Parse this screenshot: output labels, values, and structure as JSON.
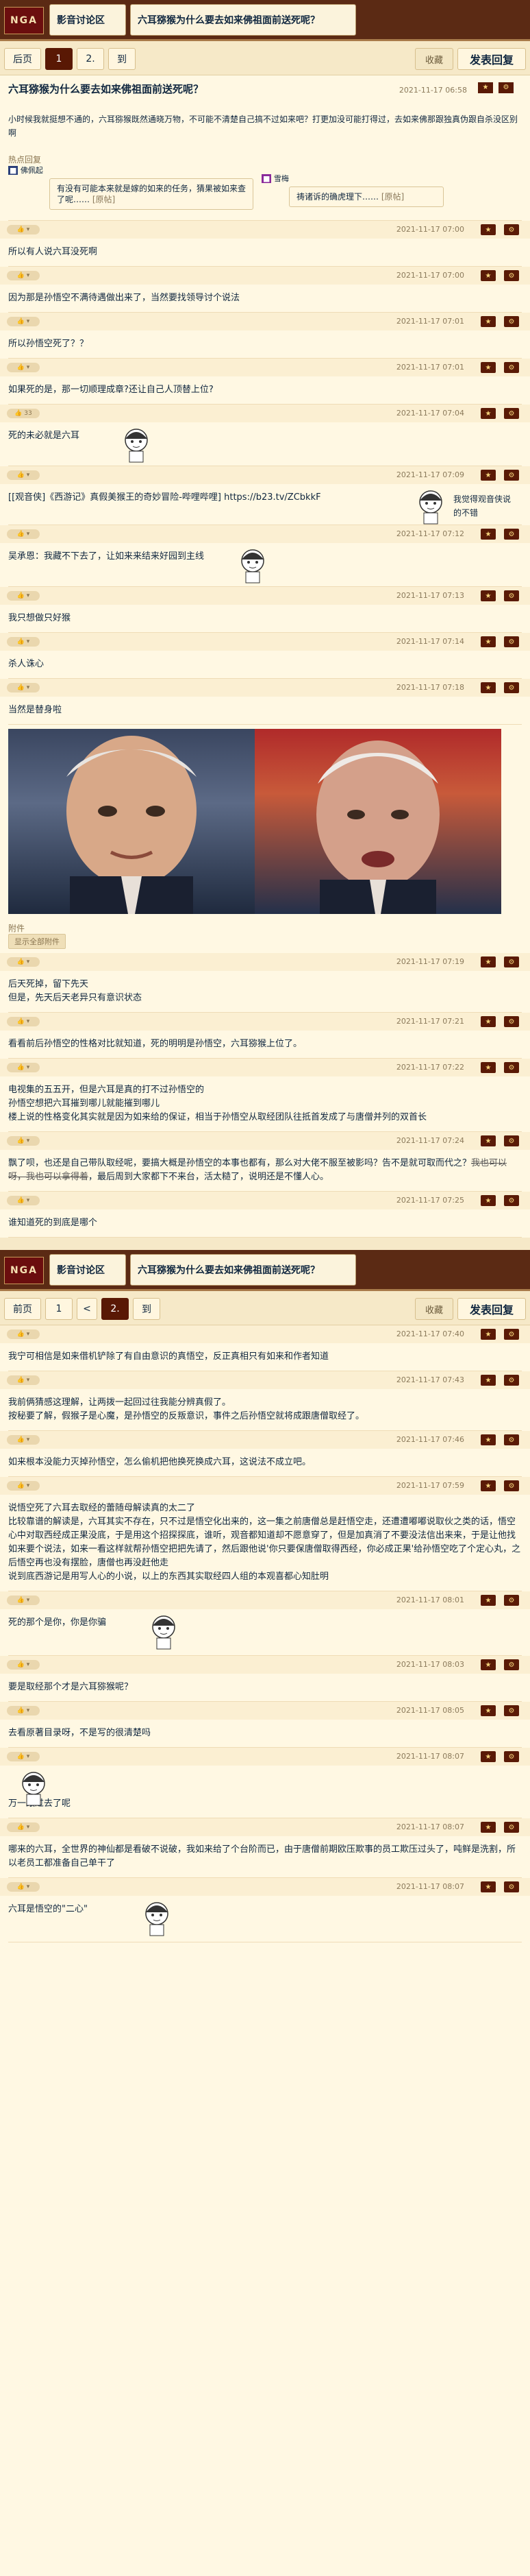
{
  "header": {
    "logo": "NGA",
    "forum": "影音讨论区",
    "thread_title": "六耳猕猴为什么要去如来佛祖面前送死呢？"
  },
  "pager1": {
    "prev": "后页",
    "p1": "1",
    "p2": "2.",
    "last": "到",
    "fav": "收藏",
    "reply": "发表回复"
  },
  "pager2": {
    "prev": "前页",
    "p1": "1",
    "lt": "<",
    "p2": "2.",
    "last": "到",
    "fav": "收藏",
    "reply": "发表回复"
  },
  "op": {
    "title": "六耳猕猴为什么要去如来佛祖面前送死呢？",
    "time": "2021-11-17 06:58",
    "text": "小时候我就挺想不通的，六耳猕猴既然通晓万物，不可能不清楚自己搞不过如来吧？打更加没可能打得过，去如来佛那跟独真伪跟自杀没区别啊"
  },
  "hot": {
    "label": "热点回复",
    "user1": "佛佩起",
    "user2": "雪梅",
    "quote1": "有没有可能本来就是嫁的如来的任务，猜果被如来查了呢……",
    "quote1_more": "[原帖]",
    "quote2": "祷诸诉的确虎理下……",
    "quote2_more": "[原帖]"
  },
  "replies": [
    {
      "time": "2021-11-17 07:00",
      "likes": "",
      "text": "所以有人说六耳没死啊"
    },
    {
      "time": "2021-11-17 07:00",
      "likes": "",
      "text": "因为那是孙悟空不满待遇做出来了，当然要找领导讨个说法"
    },
    {
      "time": "2021-11-17 07:01",
      "likes": "",
      "text": "所以孙悟空死了？？"
    },
    {
      "time": "2021-11-17 07:01",
      "likes": "",
      "text": "如果死的是，那一切顺理成章?还让自己人顶替上位?"
    },
    {
      "time": "2021-11-17 07:04",
      "likes": "33",
      "text": "死的未必就是六耳"
    },
    {
      "time": "2021-11-17 07:09",
      "likes": "",
      "text": "[[观音侠]《西游记》真假美猴王的奇妙冒险-哔哩哔哩] https://b23.tv/ZCbkkF",
      "text2": "我觉得观音侠说的不错"
    },
    {
      "time": "2021-11-17 07:12",
      "likes": "",
      "text": "吴承恩：我藏不下去了，让如来来结来好园到主线"
    },
    {
      "time": "2021-11-17 07:13",
      "likes": "",
      "text": "我只想做只好猴"
    },
    {
      "time": "2021-11-17 07:14",
      "likes": "",
      "text": "杀人诛心"
    },
    {
      "time": "2021-11-17 07:18",
      "likes": "",
      "text": "当然是替身啦"
    }
  ],
  "attach": {
    "label": "附件",
    "button": "显示全部附件"
  },
  "replies2": [
    {
      "time": "2021-11-17 07:19",
      "text": "后天死掉，留下先天",
      "text2": "但是，先天后天老异只有意识状态"
    },
    {
      "time": "2021-11-17 07:21",
      "text": "看看前后孙悟空的性格对比就知道，死的明明是孙悟空，六耳猕猴上位了。"
    },
    {
      "time": "2021-11-17 07:22",
      "text": "电视集的五五开，但是六耳是真的打不过孙悟空的",
      "text2": "孙悟空想把六耳摧到哪儿就能摧到哪儿",
      "text3": "楼上说的性格变化其实就是因为如来给的保证，相当于孙悟空从取经团队往抵首发成了与唐僧并列的双首长"
    },
    {
      "time": "2021-11-17 07:24",
      "text": "飘了呗，也还是自己带队取经呢，要搞大概是孙悟空的本事也都有，那么对大佬不服至被影吗？告不是就可取而代之？",
      "strike": "我也可以呀，我也可以拿得着",
      "text_end": "，最后周到大家都下不来台，活太糙了，说明还是不懂人心。"
    },
    {
      "time": "2021-11-17 07:25",
      "text": "谁知道死的到底是哪个"
    }
  ],
  "page2": [
    {
      "time": "2021-11-17 07:40",
      "text": "我宁可相信是如来借机铲除了有自由意识的真悟空，反正真相只有如来和作者知道"
    },
    {
      "time": "2021-11-17 07:43",
      "text": "我前俩猜感这理解，让两拨一起回过往我能分辨真假了。",
      "text2": "按秘要了解，假猴子是心魔，是孙悟空的反叛意识，事件之后孙悟空就将成跟唐僧取经了。"
    },
    {
      "time": "2021-11-17 07:46",
      "text": "如来根本没能力灭掉孙悟空，怎么偷机把他换死换成六耳，这说法不成立吧。"
    },
    {
      "time": "2021-11-17 07:59",
      "text": "说悟空死了六耳去取经的蕾随母解读真的太二了",
      "text2": "比较靠谱的解读是，六耳其实不存在，只不过是悟空化出来的，这一集之前唐僧总是赶悟空走，还遭遭嘟嘟说取伙之类的话，悟空心中对取西经成正果没底，于是用这个招探探底，谁听，观音都知道却不愿意穿了，但是加真消了不要没法信出来来，于是让他找如来要个说法，如来一看这样就帮孙悟空把把先请了，然后跟他说'你只要保唐僧取得西经，你必成正果'给孙悟空吃了个定心丸，之后悟空再也没有摆脸，唐僧也再没赶他走",
      "text3": "说到底西游记是用写人心的小说，以上的东西其实取经四人组的本观喜都心知肚明"
    },
    {
      "time": "2021-11-17 08:01",
      "text": "死的那个是你，你是你骗"
    },
    {
      "time": "2021-11-17 08:03",
      "text": "要是取经那个才是六耳猕猴呢？"
    },
    {
      "time": "2021-11-17 08:05",
      "text": "去看原著目录呀，不是写的很清楚吗"
    },
    {
      "time": "2021-11-17 08:07",
      "text": "万一跟过去了呢"
    },
    {
      "time": "2021-11-17 08:07",
      "text": "哪来的六耳，全世界的神仙都是看破不说破，我如来给了个台阶而已，由于唐僧前期欧压欺事的员工欺压过头了，吨鲜是洗割，所以老员工都准备自己单干了"
    },
    {
      "time": "2021-11-17 08:07",
      "text": "六耳是悟空的\"二心\""
    }
  ],
  "colors": {
    "accent": "#591804",
    "bg": "#fff8e3",
    "header": "#5b2a14"
  }
}
